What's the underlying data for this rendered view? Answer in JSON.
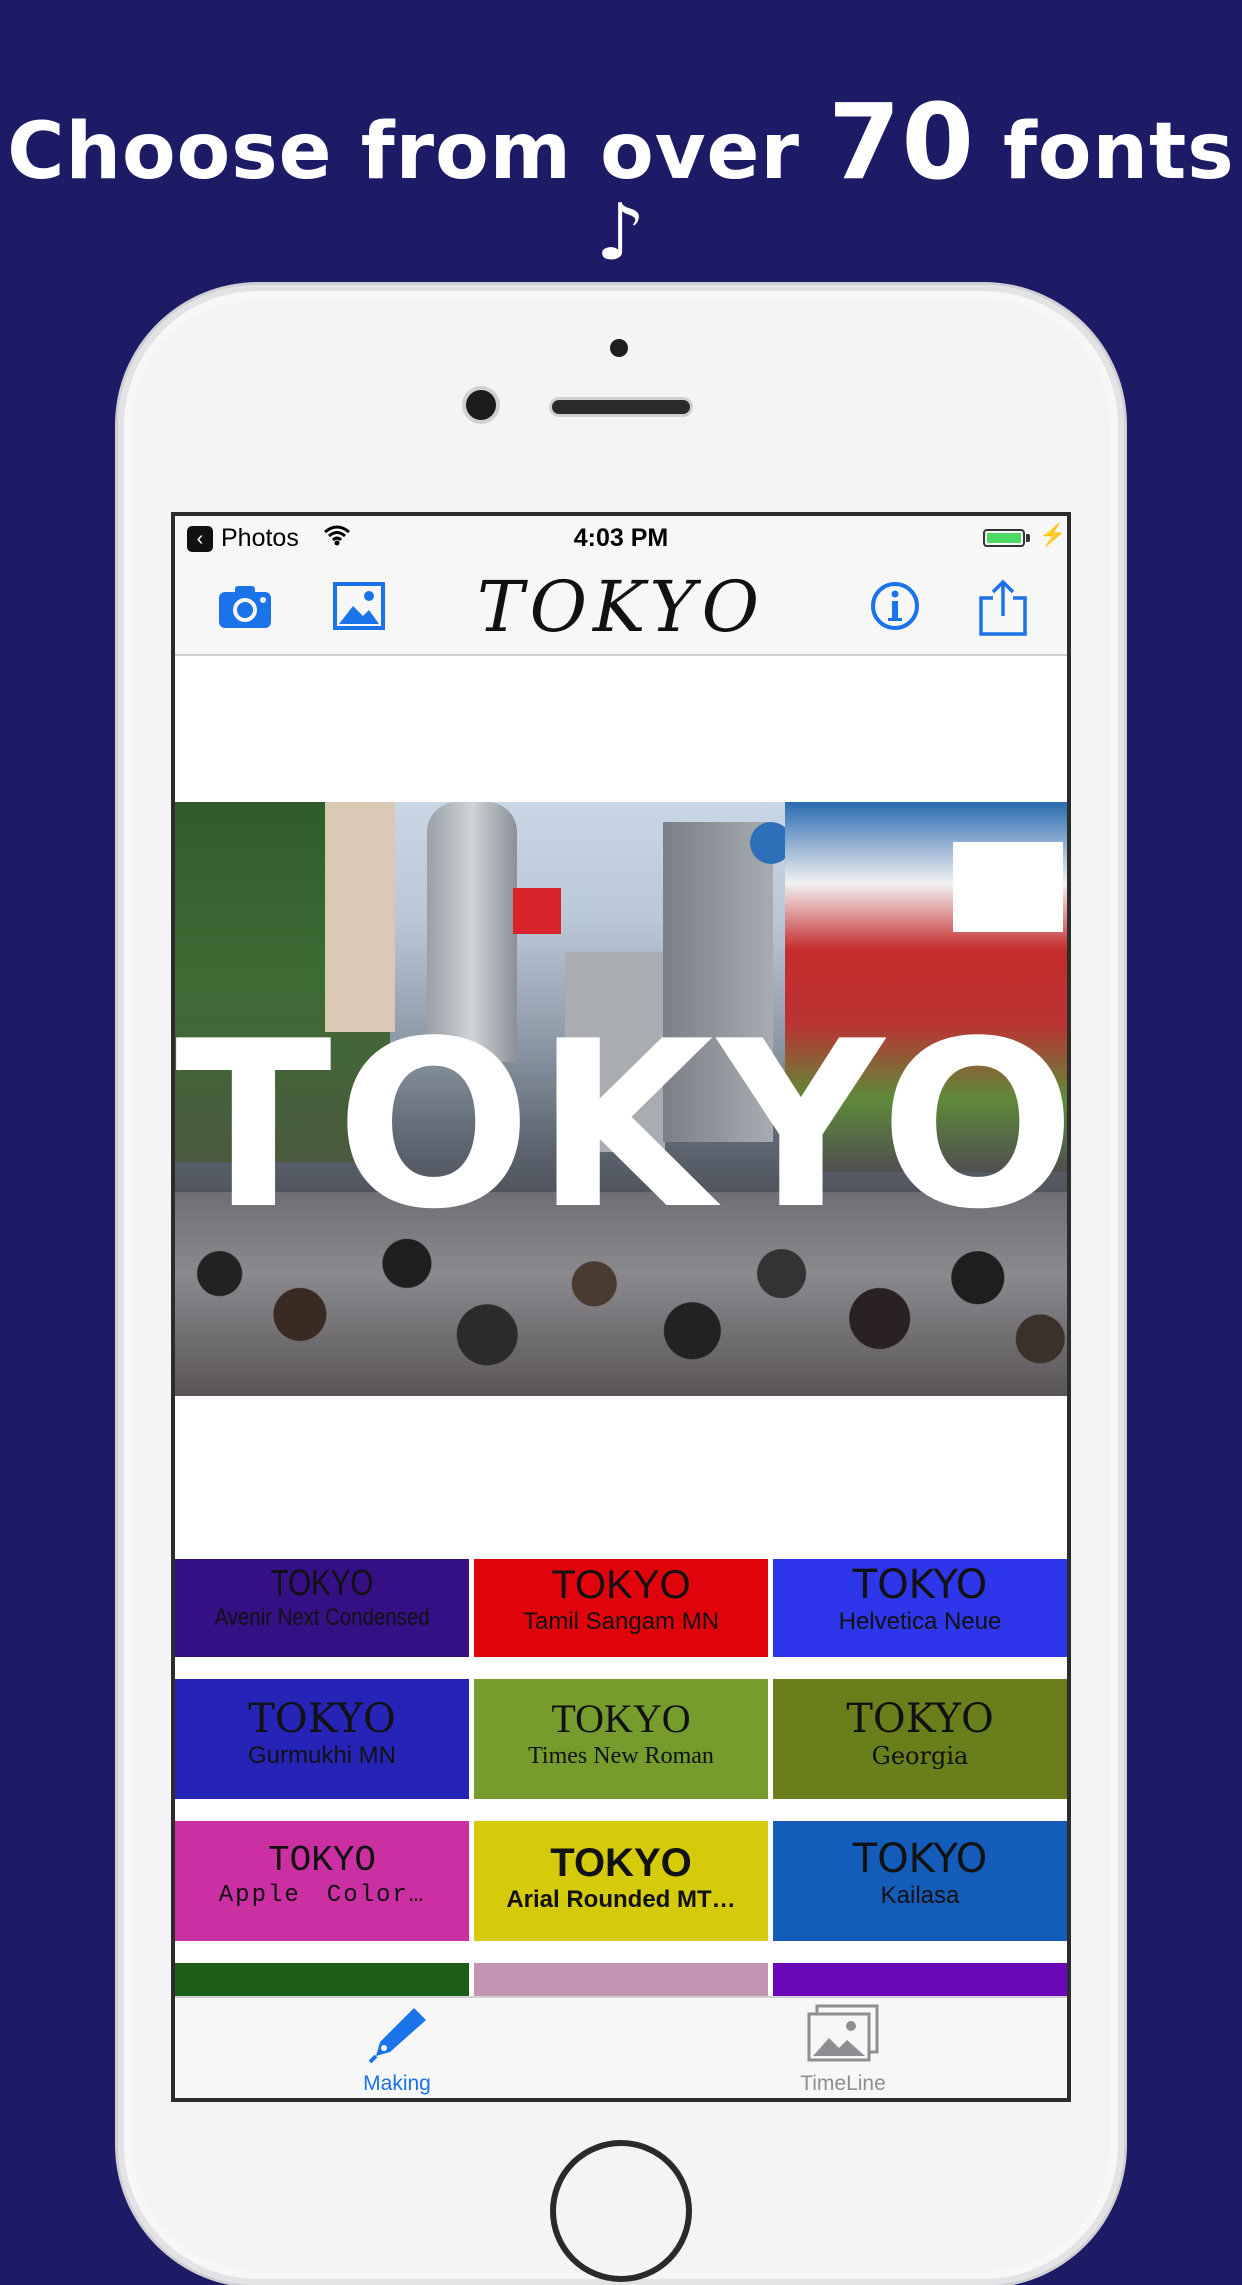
{
  "headline": {
    "prefix": "Choose from over ",
    "number": "70",
    "suffix": " fonts ♪"
  },
  "statusbar": {
    "back_app": "Photos",
    "time": "4:03 PM"
  },
  "navbar": {
    "title": "TOKYO",
    "icons": [
      "camera-icon",
      "photo-library-icon",
      "info-icon",
      "share-icon"
    ]
  },
  "photo": {
    "overlay_text": "TOKYO"
  },
  "font_tiles": [
    {
      "sample": "TOKYO",
      "font": "Avenir Next Condensed",
      "color": "#350f84"
    },
    {
      "sample": "TOKYO",
      "font": "Tamil Sangam MN",
      "color": "#e1030c"
    },
    {
      "sample": "TOKYO",
      "font": "Helvetica Neue",
      "color": "#2d36e8"
    },
    {
      "sample": "TOKYO",
      "font": "Gurmukhi MN",
      "color": "#2624b6"
    },
    {
      "sample": "TOKYO",
      "font": "Times New Roman",
      "color": "#759c2d"
    },
    {
      "sample": "TOKYO",
      "font": "Georgia",
      "color": "#6a7e1b"
    },
    {
      "sample": "TOKYO",
      "font": "Apple　Color…",
      "color": "#cc2fa2"
    },
    {
      "sample": "TOKYO",
      "font": "Arial Rounded MT…",
      "color": "#d6cb0a"
    },
    {
      "sample": "TOKYO",
      "font": "Kailasa",
      "color": "#145cba"
    },
    {
      "sample": "",
      "font": "",
      "color": "#1d5d1a"
    },
    {
      "sample": "",
      "font": "",
      "color": "#c394b3"
    },
    {
      "sample": "",
      "font": "",
      "color": "#6b08b8"
    }
  ],
  "tabbar": {
    "making": {
      "label": "Making",
      "color": "#1a73e8"
    },
    "timeline": {
      "label": "TimeLine",
      "color": "#8e8e93"
    }
  }
}
